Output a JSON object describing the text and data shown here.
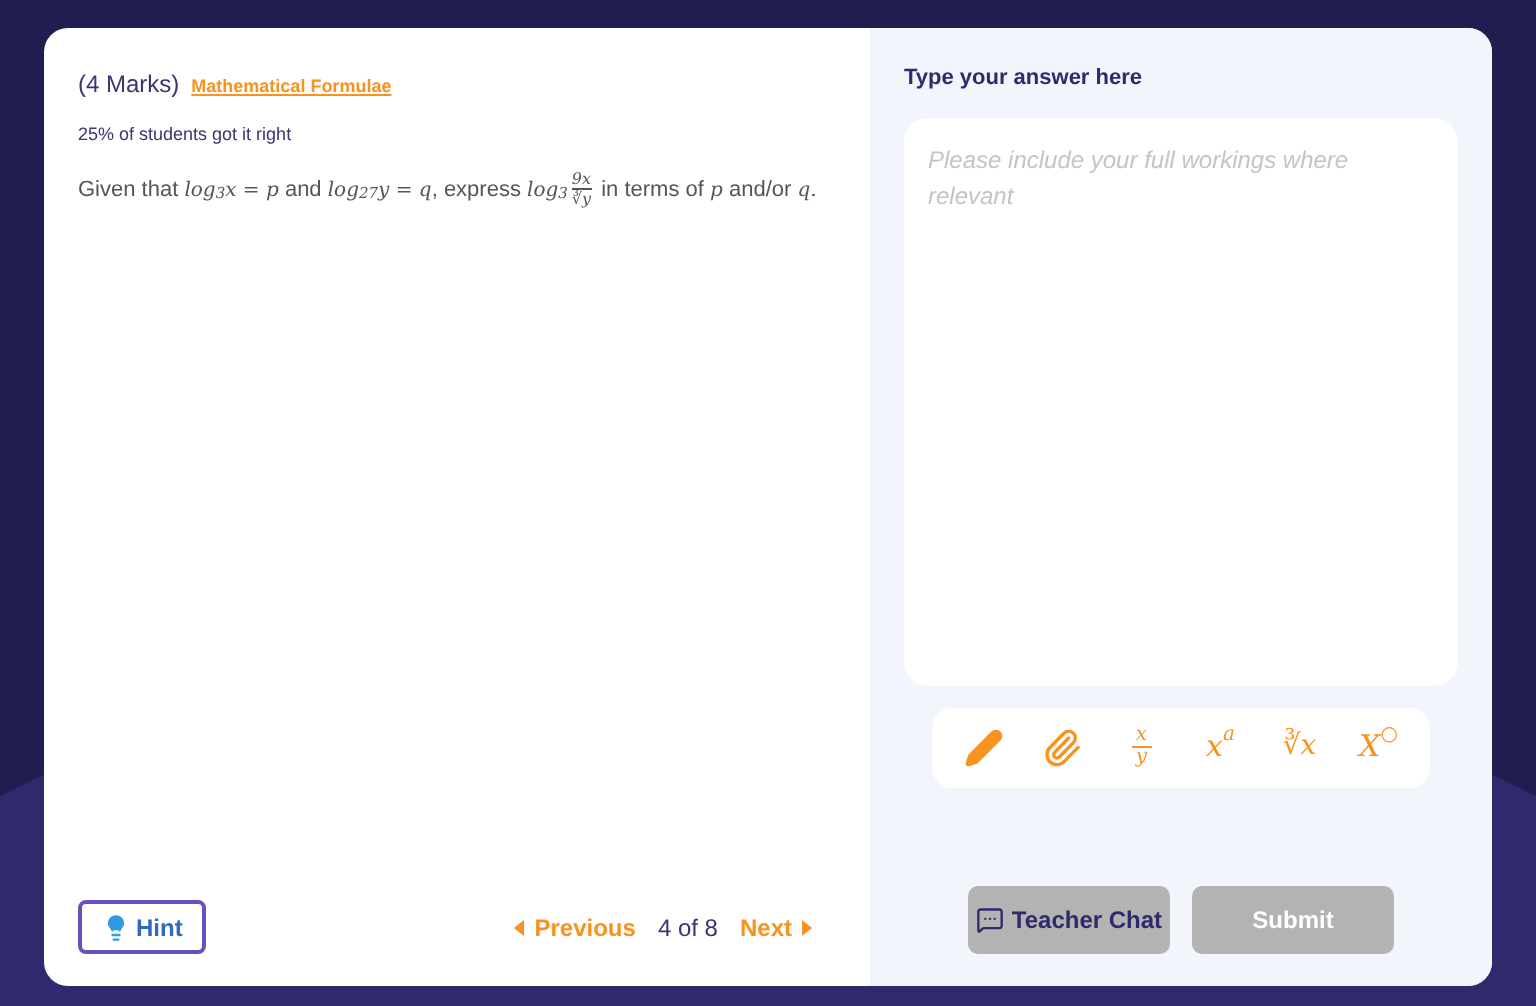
{
  "question": {
    "marks": "(4 Marks)",
    "formulae_link": "Mathematical Formulae",
    "stats": "25% of students got it right",
    "segments": [
      {
        "kind": "text",
        "text": "Given that "
      },
      {
        "kind": "math",
        "text": "log$_{3}$x = p"
      },
      {
        "kind": "text",
        "text": " and "
      },
      {
        "kind": "math",
        "text": "log$_{27}$y = q"
      },
      {
        "kind": "text",
        "text": ", express "
      },
      {
        "kind": "math",
        "text": "log$_{3}$"
      },
      {
        "kind": "fraction",
        "top": "9x",
        "bottom": "∛y"
      },
      {
        "kind": "text",
        "text": " in terms of "
      },
      {
        "kind": "math",
        "text": "p"
      },
      {
        "kind": "text",
        "text": " and/or "
      },
      {
        "kind": "math",
        "text": "q."
      }
    ]
  },
  "hint_button": "Hint",
  "pagination": {
    "previous": "Previous",
    "position": "4 of 8",
    "next": "Next"
  },
  "answer": {
    "label": "Type your answer here",
    "placeholder": "Please include your full workings where relevant"
  },
  "tools": [
    {
      "kind": "pencil"
    },
    {
      "kind": "attach"
    },
    {
      "kind": "fraction",
      "top": "x",
      "bottom": "y"
    },
    {
      "kind": "power",
      "base": "x",
      "exp": "a"
    },
    {
      "kind": "text",
      "text": "∛x"
    },
    {
      "kind": "power",
      "base": "X",
      "exp": "○"
    }
  ],
  "teacher_chat": "Teacher Chat",
  "submit": {
    "label": "Submit",
    "disabled": true
  }
}
